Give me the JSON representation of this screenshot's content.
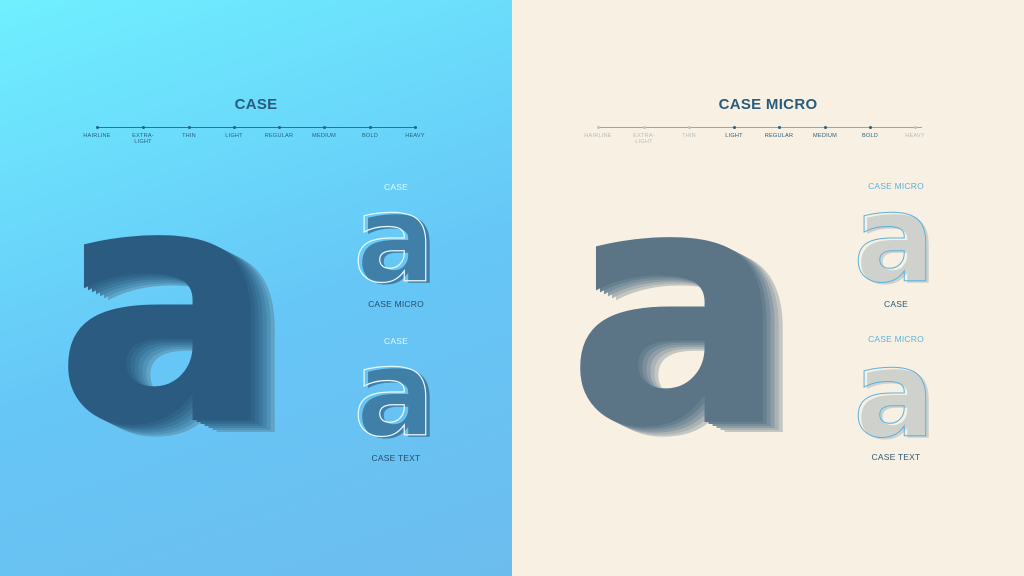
{
  "left": {
    "title": "CASE",
    "weights": [
      "HAIRLINE",
      "EXTRA-\nLIGHT",
      "THIN",
      "LIGHT",
      "REGULAR",
      "MEDIUM",
      "BOLD",
      "HEAVY"
    ],
    "glyph": "a",
    "compare_top": {
      "label_above": "CASE",
      "label_below": "CASE MICRO"
    },
    "compare_bottom": {
      "label_above": "CASE",
      "label_below": "CASE TEXT"
    }
  },
  "right": {
    "title": "CASE MICRO",
    "weights": [
      "HAIRLINE",
      "EXTRA-\nLIGHT",
      "THIN",
      "LIGHT",
      "REGULAR",
      "MEDIUM",
      "BOLD",
      "HEAVY"
    ],
    "glyph": "a",
    "compare_top": {
      "label_above": "CASE MICRO",
      "label_below": "CASE"
    },
    "compare_bottom": {
      "label_above": "CASE MICRO",
      "label_below": "CASE TEXT"
    }
  },
  "colors": {
    "left_gradient_top": "#6ff0ff",
    "left_gradient_bottom": "#6cbdee",
    "right_background": "#f7f0e3",
    "title_color": "#2a5c7e",
    "glyph_dark": "#2f5d7c",
    "glyph_grey": "#c9ccc7"
  }
}
